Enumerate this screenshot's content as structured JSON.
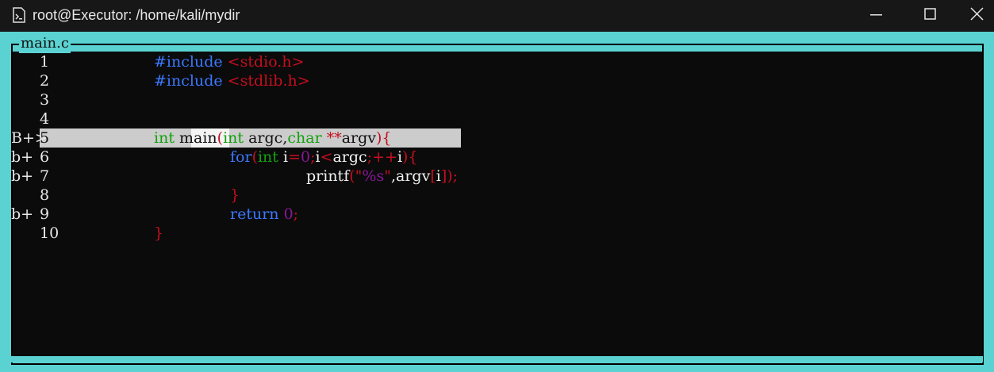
{
  "window": {
    "title": "root@Executor: /home/kali/mydir",
    "icon": "terminal-file-icon",
    "controls": {
      "minimize": "minimize-icon",
      "maximize": "maximize-icon",
      "close": "close-icon"
    }
  },
  "source": {
    "file_name": "main.c",
    "colors": {
      "frame": "#5bd2d2",
      "background": "#0b0b0b",
      "keyword_blue": "#3b78ff",
      "keyword_green": "#13a10e",
      "red": "#c50f1f",
      "purple": "#881798",
      "highlight": "#cccccc"
    },
    "lines": [
      {
        "bp": "",
        "num": "1"
      },
      {
        "bp": "",
        "num": "2"
      },
      {
        "bp": "",
        "num": "3"
      },
      {
        "bp": "",
        "num": "4"
      },
      {
        "bp": "B+>",
        "num": "5"
      },
      {
        "bp": "b+",
        "num": "6"
      },
      {
        "bp": "b+",
        "num": "7"
      },
      {
        "bp": "",
        "num": "8"
      },
      {
        "bp": "b+",
        "num": "9"
      },
      {
        "bp": "",
        "num": "10"
      }
    ],
    "tokens": {
      "l1": [
        "#include",
        "<stdio.h>"
      ],
      "l2": [
        "#include",
        "<stdlib.h>"
      ],
      "l5": [
        "int",
        "main",
        "(",
        "int",
        "argc,",
        "char",
        "**",
        "argv",
        "){"
      ],
      "l6": [
        "for",
        "(",
        "int",
        "i",
        "=",
        "0",
        ";",
        "i",
        "<",
        "argc",
        ";",
        "++",
        "i",
        "){"
      ],
      "l7": [
        "printf",
        "(\"",
        "%s",
        "\"",
        ",argv",
        "[",
        "i",
        "]);"
      ],
      "l8": [
        "}"
      ],
      "l9": [
        "return",
        "0",
        ";"
      ],
      "l10": [
        "}"
      ]
    }
  }
}
